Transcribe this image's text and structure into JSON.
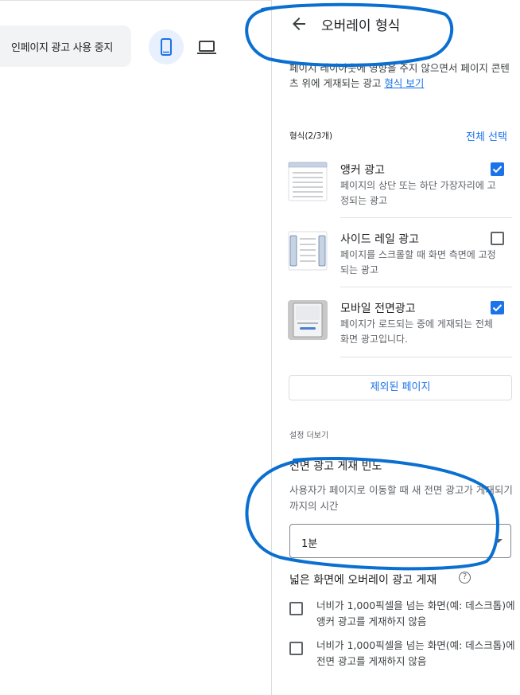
{
  "left": {
    "stop_button": "인페이지 광고 사용 중지",
    "device_mobile_icon": "smartphone-icon",
    "device_desktop_icon": "laptop-icon"
  },
  "panel": {
    "back_icon": "arrow-back-icon",
    "title": "오버레이 형식",
    "description": "페이지 레이아웃에 영향을 주지 않으면서 페이지 콘텐츠 위에 게재되는 광고",
    "description_link": "형식 보기",
    "formats_label": "형식(2/3개)",
    "select_all": "전체 선택",
    "formats": [
      {
        "name": "앵커 광고",
        "desc": "페이지의 상단 또는 하단 가장자리에 고정되는 광고",
        "checked": true,
        "icon": "anchor-ad-icon"
      },
      {
        "name": "사이드 레일 광고",
        "desc": "페이지를 스크롤할 때 화면 측면에 고정되는 광고",
        "checked": false,
        "icon": "side-rail-ad-icon"
      },
      {
        "name": "모바일 전면광고",
        "desc": "페이지가 로드되는 중에 게재되는 전체 화면 광고입니다.",
        "checked": true,
        "icon": "vignette-ad-icon"
      }
    ],
    "excluded_pages": "제외된 페이지",
    "more_settings": "설정 더보기",
    "frequency": {
      "title": "전면 광고 게재 빈도",
      "desc": "사용자가 페이지로 이동할 때 새 전면 광고가 게재되기까지의 시간",
      "value": "1분"
    },
    "wide_screen": {
      "title": "넓은 화면에 오버레이 광고 게재",
      "help_icon": "help-icon",
      "options": [
        {
          "text": "너비가 1,000픽셀을 넘는 화면(예: 데스크톱)에 앵커 광고를 게재하지 않음",
          "checked": false
        },
        {
          "text": "너비가 1,000픽셀을 넘는 화면(예: 데스크톱)에 전면 광고를 게재하지 않음",
          "checked": false
        }
      ]
    }
  },
  "colors": {
    "accent": "#1a73e8",
    "marker": "#0a6fd0"
  }
}
